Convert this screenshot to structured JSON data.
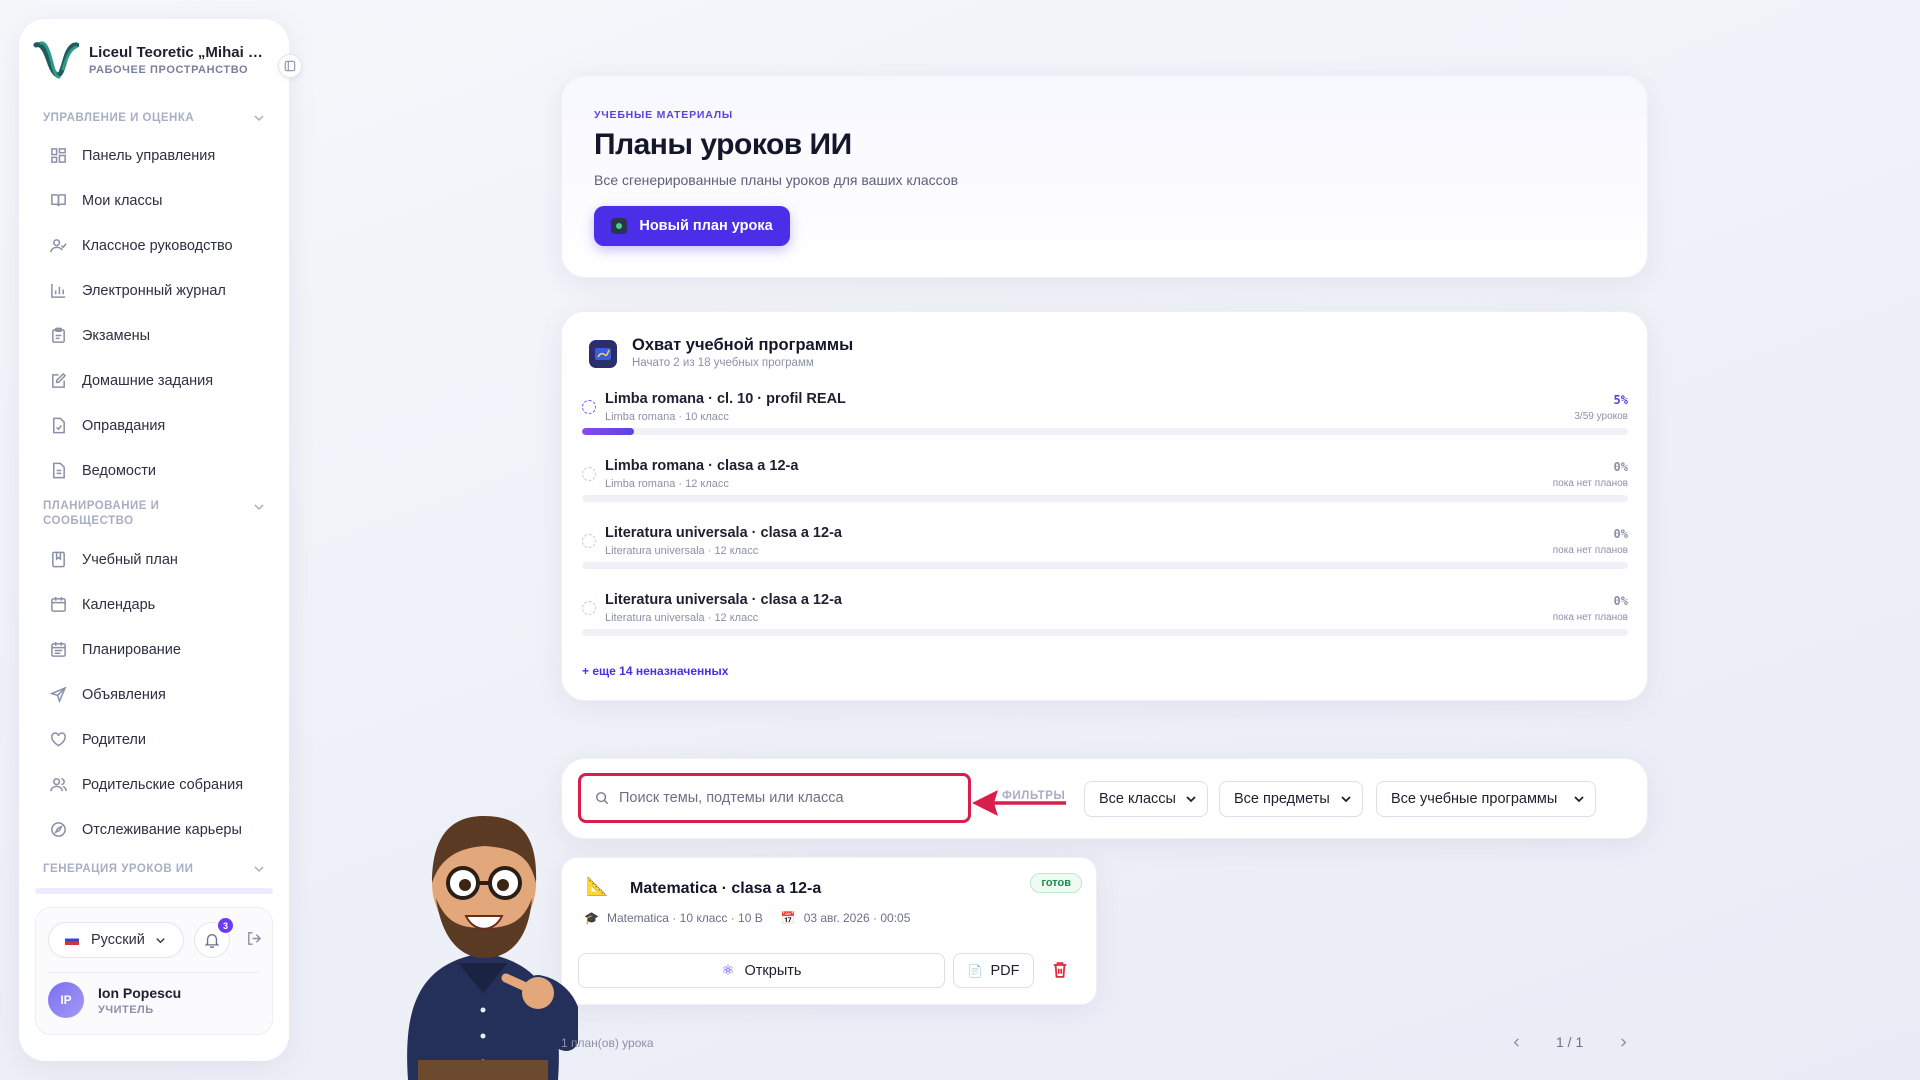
{
  "sidebar": {
    "workspace_name": "Liceul Teoretic „Mihai Eminescu”",
    "workspace_sub": "РАБОЧЕЕ ПРОСТРАНСТВО",
    "sections": [
      {
        "title": "УПРАВЛЕНИЕ И ОЦЕНКА"
      },
      {
        "title": "ПЛАНИРОВАНИЕ И СООБЩЕСТВО"
      },
      {
        "title": "ГЕНЕРАЦИЯ УРОКОВ ИИ"
      }
    ],
    "items_group1": [
      {
        "label": "Панель управления",
        "icon": "dashboard-icon"
      },
      {
        "label": "Мои классы",
        "icon": "book-icon"
      },
      {
        "label": "Классное руководство",
        "icon": "user-check-icon"
      },
      {
        "label": "Электронный журнал",
        "icon": "bar-chart-icon"
      },
      {
        "label": "Экзамены",
        "icon": "clipboard-icon"
      },
      {
        "label": "Домашние задания",
        "icon": "edit-icon"
      },
      {
        "label": "Оправдания",
        "icon": "file-check-icon"
      },
      {
        "label": "Ведомости",
        "icon": "file-text-icon"
      }
    ],
    "items_group2": [
      {
        "label": "Учебный план",
        "icon": "notebook-icon"
      },
      {
        "label": "Календарь",
        "icon": "calendar-icon"
      },
      {
        "label": "Планирование",
        "icon": "calendar-lines-icon"
      },
      {
        "label": "Объявления",
        "icon": "send-icon"
      },
      {
        "label": "Родители",
        "icon": "heart-icon"
      },
      {
        "label": "Родительские собрания",
        "icon": "users-icon"
      },
      {
        "label": "Отслеживание карьеры",
        "icon": "compass-icon"
      }
    ],
    "language": "Русский",
    "notifications_count": "3",
    "user": {
      "initials": "IP",
      "name": "Ion Popescu",
      "role": "УЧИТЕЛЬ"
    }
  },
  "hero": {
    "eyebrow": "УЧЕБНЫЕ МАТЕРИАЛЫ",
    "title": "Планы уроков ИИ",
    "description": "Все сгенерированные планы уроков для ваших классов",
    "new_button": "Новый план урока"
  },
  "coverage": {
    "title": "Охват учебной программы",
    "subtitle": "Начато 2 из 18 учебных программ",
    "rows": [
      {
        "name": "Limba romana · cl. 10 · profil REAL",
        "meta": "Limba romana · 10 класс",
        "pct": "5%",
        "note": "3/59 уроков",
        "progress": 0.05,
        "active": true
      },
      {
        "name": "Limba romana · clasa a 12-a",
        "meta": "Limba romana · 12 класс",
        "pct": "0%",
        "note": "пока нет планов",
        "progress": 0,
        "active": false
      },
      {
        "name": "Literatura universala · clasa a 12-a",
        "meta": "Literatura universala · 12 класс",
        "pct": "0%",
        "note": "пока нет планов",
        "progress": 0,
        "active": false
      },
      {
        "name": "Literatura universala · clasa a 12-a",
        "meta": "Literatura universala · 12 класс",
        "pct": "0%",
        "note": "пока нет планов",
        "progress": 0,
        "active": false
      }
    ],
    "more_link": "+ еще 14 неназначенных"
  },
  "filters": {
    "search_placeholder": "Поиск темы, подтемы или класса",
    "label": "ФИЛЬТРЫ",
    "class_select": "Все классы",
    "subject_select": "Все предметы",
    "program_select": "Все учебные программы"
  },
  "plan_card": {
    "title": "Matematica · clasa a 12-a",
    "status": "готов",
    "subject_meta": "Matematica · 10 класс · 10 B",
    "date_meta": "03 авг. 2026 · 00:05",
    "open_button": "Открыть",
    "pdf_button": "PDF"
  },
  "footer": {
    "count_text": "1 план(ов) урока",
    "page": "1 / 1"
  },
  "colors": {
    "accent": "#4a2ee8",
    "highlight": "#d81f4c",
    "ready": "#1f8a4c"
  }
}
